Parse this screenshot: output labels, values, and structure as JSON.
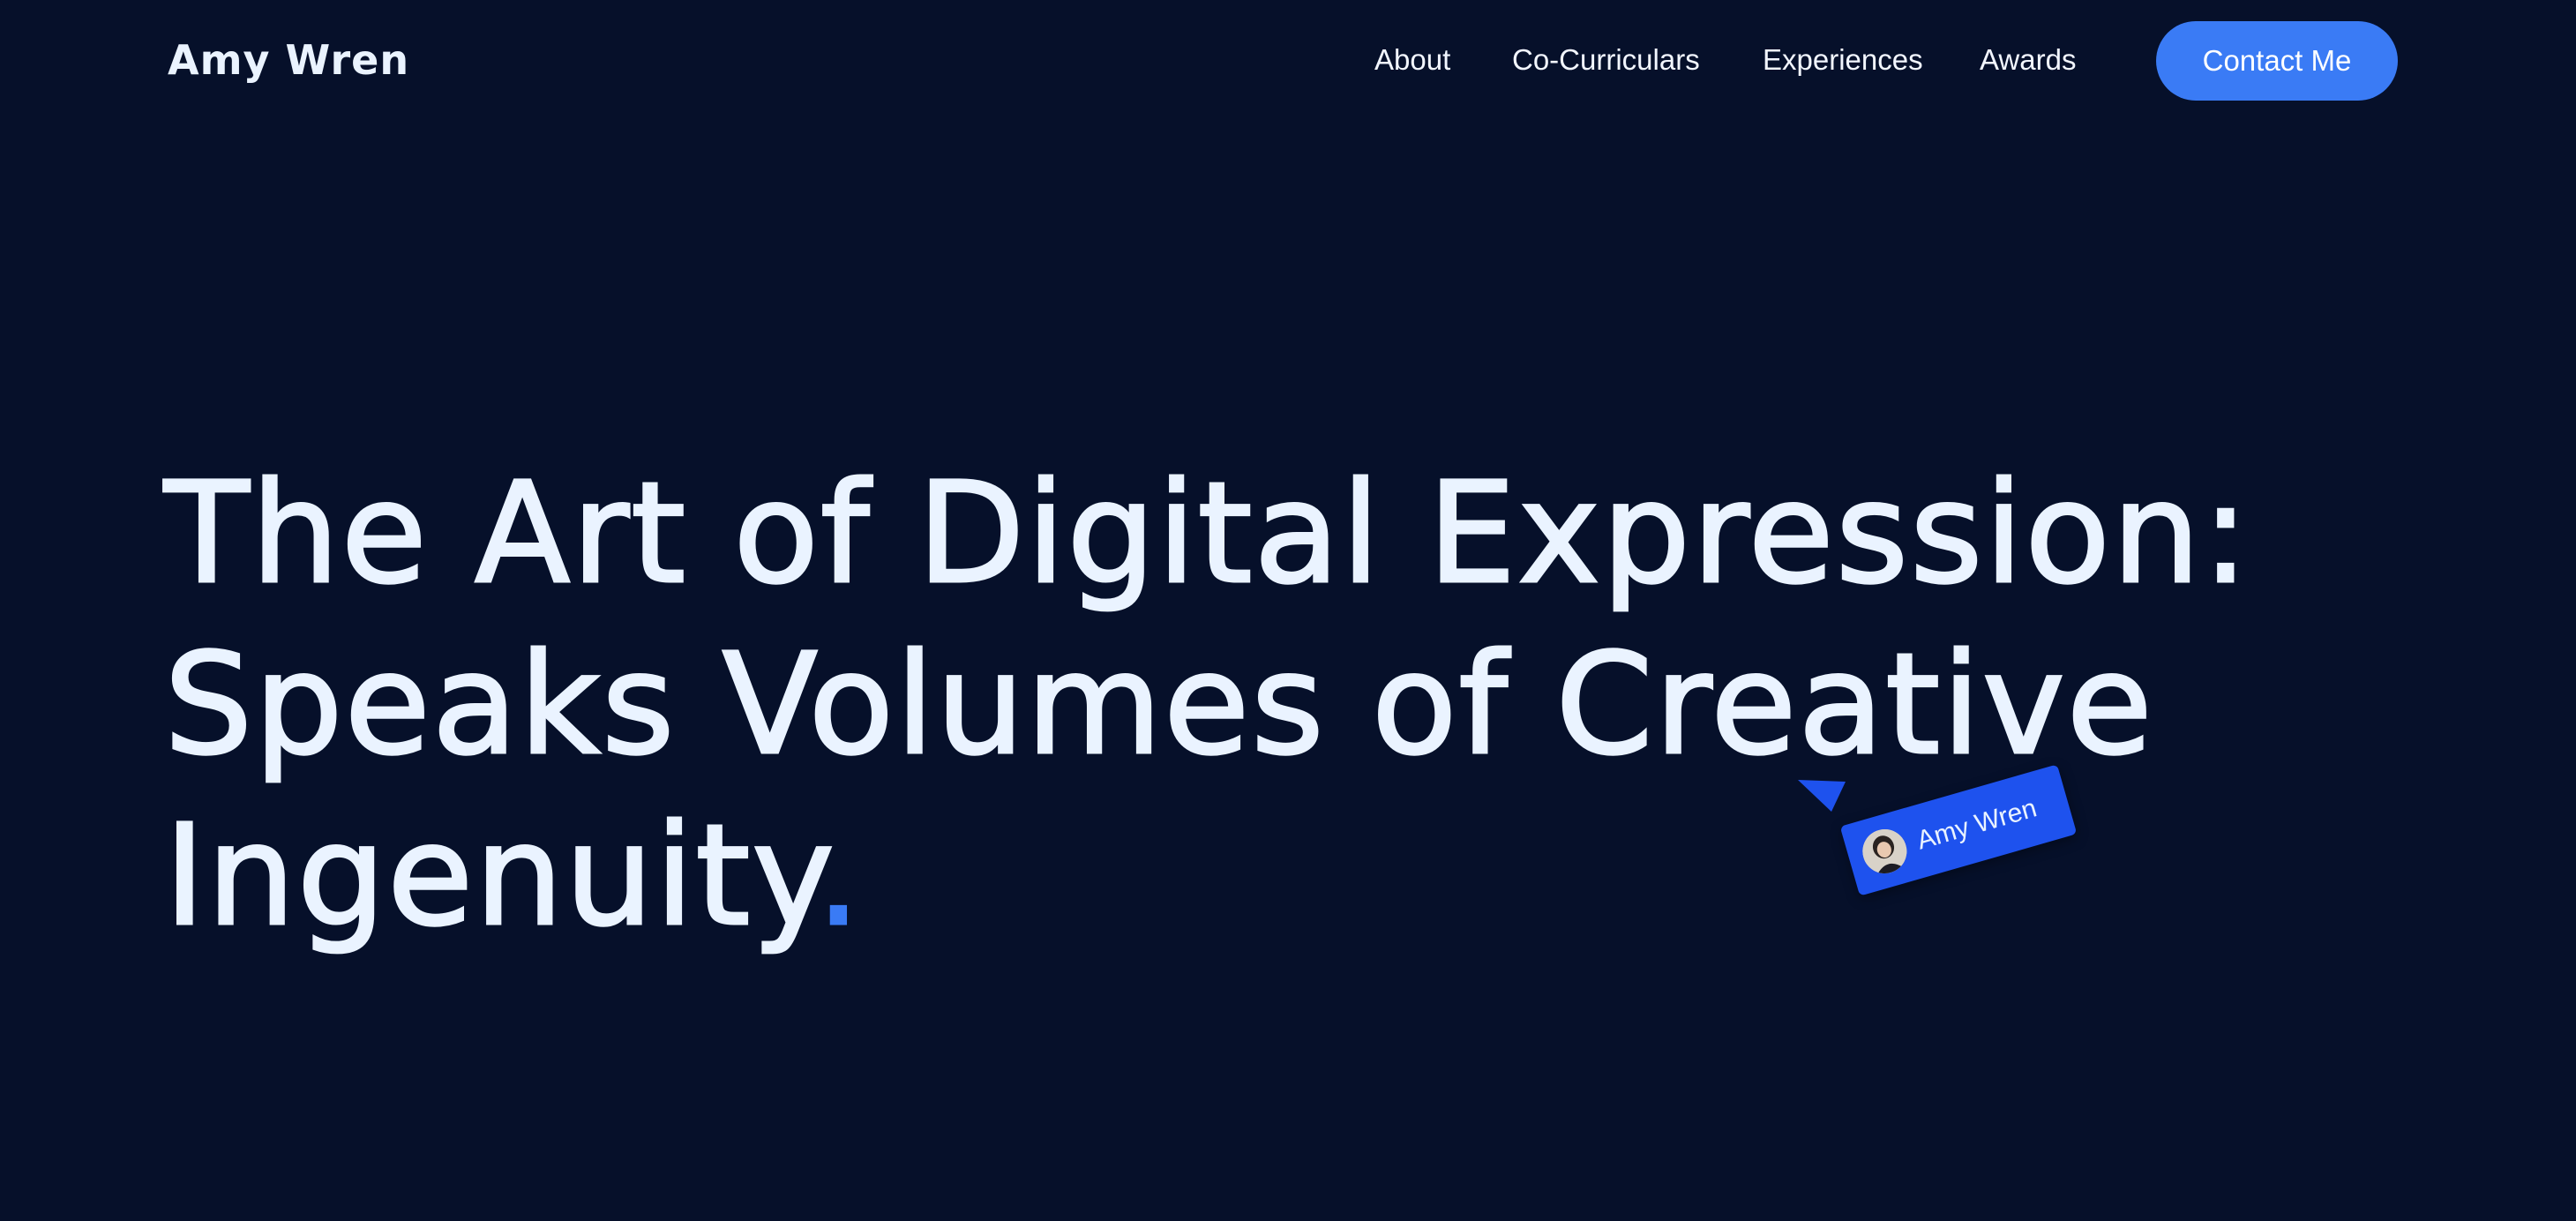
{
  "colors": {
    "background": "#06102a",
    "text": "#eaf3ff",
    "accent": "#3a7bf5",
    "tag": "#1e52ee"
  },
  "nav": {
    "brand": "Amy Wren",
    "links": [
      {
        "label": "About"
      },
      {
        "label": "Co-Curriculars"
      },
      {
        "label": "Experiences"
      },
      {
        "label": "Awards"
      }
    ],
    "contact_label": "Contact Me"
  },
  "hero": {
    "line1": "The Art of Digital Expression:",
    "line2": "Speaks Volumes of Creative",
    "line3": "Ingenuity",
    "dot": "."
  },
  "cursor_tag": {
    "name": "Amy Wren",
    "avatar_icon": "avatar-photo",
    "pointer_icon": "cursor-pointer-icon"
  }
}
